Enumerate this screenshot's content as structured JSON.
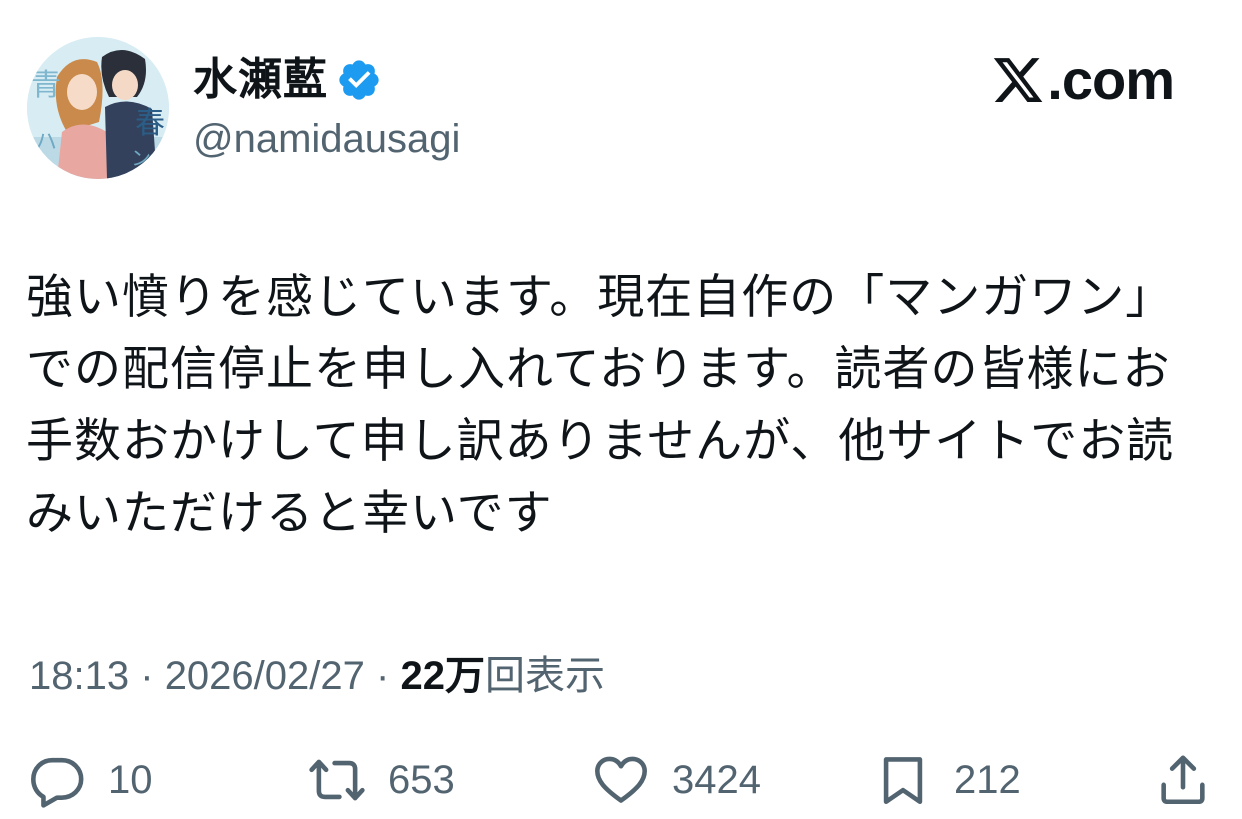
{
  "user": {
    "display_name": "水瀬藍",
    "handle": "@namidausagi",
    "verified": true,
    "verified_color": "#1d9bf0"
  },
  "brand": {
    "text": ".com",
    "icon": "x-logo-icon"
  },
  "tweet": {
    "text": "強い憤りを感じています。現在自作の「マンガワン」での配信停止を申し入れております。読者の皆様にお手数おかけして申し訳ありませんが、他サイトでお読みいただけると幸いです"
  },
  "meta": {
    "time": "18:13",
    "separator": "·",
    "date": "2026/02/27",
    "views_count": "22万",
    "views_label": "回表示"
  },
  "actions": {
    "reply": {
      "icon": "reply-icon",
      "count": "10"
    },
    "retweet": {
      "icon": "retweet-icon",
      "count": "653"
    },
    "like": {
      "icon": "heart-icon",
      "count": "3424"
    },
    "bookmark": {
      "icon": "bookmark-icon",
      "count": "212"
    },
    "share": {
      "icon": "share-icon"
    }
  },
  "colors": {
    "text_primary": "#0f1419",
    "text_secondary": "#536471",
    "icon": "#536471"
  }
}
